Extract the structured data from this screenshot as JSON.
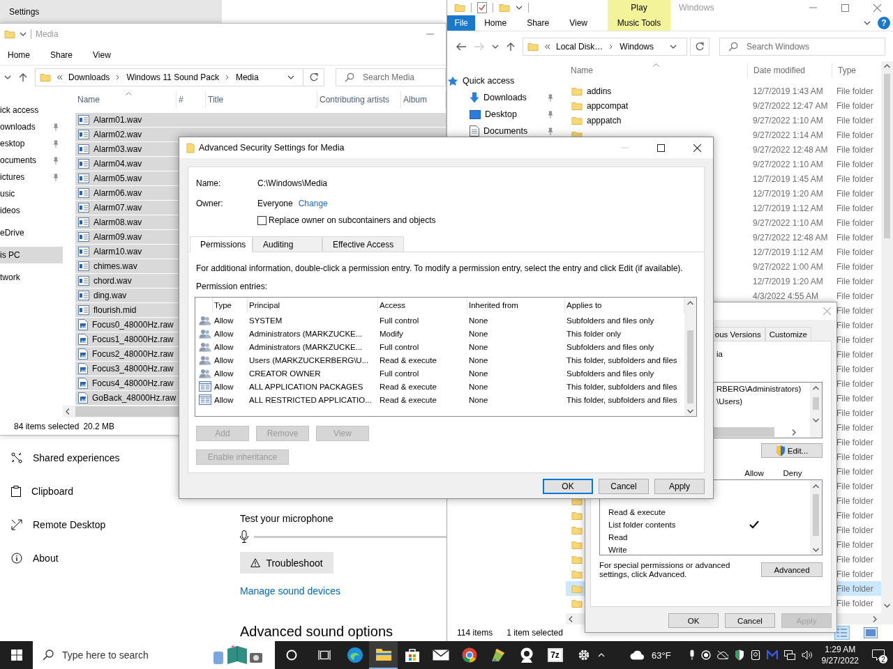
{
  "settings_window": {
    "title": "Settings",
    "nav": [
      {
        "label": "Shared experiences"
      },
      {
        "label": "Clipboard"
      },
      {
        "label": "Remote Desktop"
      },
      {
        "label": "About"
      }
    ],
    "mic_heading": "Test your microphone",
    "troubleshoot_button": "Troubleshoot",
    "manage_link": "Manage sound devices",
    "advanced_heading": "Advanced sound options"
  },
  "media_explorer": {
    "title": "Media",
    "ribbon_tabs": [
      "Home",
      "Share",
      "View"
    ],
    "breadcrumb": [
      "Downloads",
      "Windows 11 Sound Pack",
      "Media"
    ],
    "search_placeholder": "Search Media",
    "nav": [
      {
        "label": "ick access",
        "selected": false,
        "children": [
          {
            "label": "ownloads",
            "pinned": true,
            "selected": false
          },
          {
            "label": "esktop",
            "pinned": true,
            "selected": false
          },
          {
            "label": "ocuments",
            "pinned": true,
            "selected": false
          },
          {
            "label": "ictures",
            "pinned": true,
            "selected": false
          },
          {
            "label": "usic",
            "pinned": false,
            "selected": false
          },
          {
            "label": "ideos",
            "pinned": false,
            "selected": false
          }
        ]
      },
      {
        "label": "eDrive",
        "selected": false
      },
      {
        "label": "is PC",
        "selected": true
      },
      {
        "label": "twork",
        "selected": false
      }
    ],
    "columns": [
      "Name",
      "#",
      "Title",
      "Contributing artists",
      "Album"
    ],
    "files": [
      {
        "name": "Alarm01.wav",
        "kind": "audio",
        "selected": true
      },
      {
        "name": "Alarm02.wav",
        "kind": "audio",
        "selected": true
      },
      {
        "name": "Alarm03.wav",
        "kind": "audio",
        "selected": true
      },
      {
        "name": "Alarm04.wav",
        "kind": "audio",
        "selected": true
      },
      {
        "name": "Alarm05.wav",
        "kind": "audio",
        "selected": true
      },
      {
        "name": "Alarm06.wav",
        "kind": "audio",
        "selected": true
      },
      {
        "name": "Alarm07.wav",
        "kind": "audio",
        "selected": true
      },
      {
        "name": "Alarm08.wav",
        "kind": "audio",
        "selected": true
      },
      {
        "name": "Alarm09.wav",
        "kind": "audio",
        "selected": true
      },
      {
        "name": "Alarm10.wav",
        "kind": "audio",
        "selected": true
      },
      {
        "name": "chimes.wav",
        "kind": "audio",
        "selected": true
      },
      {
        "name": "chord.wav",
        "kind": "audio",
        "selected": true
      },
      {
        "name": "ding.wav",
        "kind": "audio",
        "selected": true
      },
      {
        "name": "flourish.mid",
        "kind": "audio",
        "selected": true
      },
      {
        "name": "Focus0_48000Hz.raw",
        "kind": "raw",
        "selected": true
      },
      {
        "name": "Focus1_48000Hz.raw",
        "kind": "raw",
        "selected": true
      },
      {
        "name": "Focus2_48000Hz.raw",
        "kind": "raw",
        "selected": true
      },
      {
        "name": "Focus3_48000Hz.raw",
        "kind": "raw",
        "selected": true
      },
      {
        "name": "Focus4_48000Hz.raw",
        "kind": "raw",
        "selected": true
      },
      {
        "name": "GoBack_48000Hz.raw",
        "kind": "raw",
        "selected": true
      }
    ],
    "status": "84 items selected",
    "status_size": "20.2 MB"
  },
  "windows_explorer": {
    "title": "Windows",
    "context_tab": {
      "header": "Play",
      "label": "Music Tools"
    },
    "ribbon_tabs": [
      {
        "label": "File",
        "kind": "file_menu"
      },
      {
        "label": "Home",
        "kind": "tab"
      },
      {
        "label": "Share",
        "kind": "tab"
      },
      {
        "label": "View",
        "kind": "tab"
      }
    ],
    "breadcrumb": [
      "Local Disk…",
      "Windows"
    ],
    "search_placeholder": "Search Windows",
    "nav": [
      {
        "label": "Quick access",
        "selected": false,
        "children": [
          {
            "label": "Downloads",
            "pinned": true,
            "selected": false
          },
          {
            "label": "Desktop",
            "pinned": true,
            "selected": false
          },
          {
            "label": "Documents",
            "pinned": true,
            "selected": false
          }
        ]
      }
    ],
    "columns": [
      "Name",
      "Date modified",
      "Type"
    ],
    "rows": [
      {
        "name": "addins",
        "date": "12/7/2019 1:43 AM",
        "type": "File folder",
        "selected": false
      },
      {
        "name": "appcompat",
        "date": "9/27/2022 12:47 AM",
        "type": "File folder",
        "selected": false
      },
      {
        "name": "apppatch",
        "date": "9/27/2022 1:10 AM",
        "type": "File folder",
        "selected": false
      },
      {
        "date": "9/27/2022 1:14 AM",
        "type": "File folder",
        "selected": false
      },
      {
        "date": "9/27/2022 12:48 AM",
        "type": "File folder",
        "selected": false
      },
      {
        "date": "9/27/2022 1:10 AM",
        "type": "File folder",
        "selected": false
      },
      {
        "date": "12/7/2019 1:45 AM",
        "type": "File folder",
        "selected": false
      },
      {
        "date": "12/7/2019 1:20 AM",
        "type": "File folder",
        "selected": false
      },
      {
        "date": "12/7/2019 1:12 AM",
        "type": "File folder",
        "selected": false
      },
      {
        "date": "9/27/2022 1:10 AM",
        "type": "File folder",
        "selected": false
      },
      {
        "date": "9/27/2022 12:48 AM",
        "type": "File folder",
        "selected": false
      },
      {
        "date": "12/7/2019 1:12 AM",
        "type": "File folder",
        "selected": false
      },
      {
        "date": "9/27/2022 1:00 AM",
        "type": "File folder",
        "selected": false
      },
      {
        "date": "12/7/2019 1:20 AM",
        "type": "File folder",
        "selected": false
      },
      {
        "date": "4/3/2022 4:55 AM",
        "type": "File folder",
        "selected": false
      },
      {
        "type": "File folder",
        "selected": false
      },
      {
        "type": "File folder",
        "selected": false
      },
      {
        "type": "File folder",
        "selected": false
      },
      {
        "type": "File folder",
        "selected": false
      },
      {
        "type": "File folder",
        "selected": false
      },
      {
        "type": "File folder",
        "selected": false
      },
      {
        "type": "File folder",
        "selected": false
      },
      {
        "type": "File folder",
        "selected": false
      },
      {
        "type": "File folder",
        "selected": false
      },
      {
        "type": "File folder",
        "selected": false
      },
      {
        "type": "File folder",
        "selected": false
      },
      {
        "type": "File folder",
        "selected": false
      },
      {
        "type": "File folder",
        "selected": false
      },
      {
        "type": "File folder",
        "selected": false
      },
      {
        "type": "File folder",
        "selected": false
      },
      {
        "type": "File folder",
        "selected": false
      },
      {
        "type": "File folder",
        "selected": false
      },
      {
        "type": "File folder",
        "selected": false
      },
      {
        "type": "File folder",
        "selected": false
      },
      {
        "type": "File folder",
        "selected": true
      },
      {
        "type": "File folder",
        "selected": false
      }
    ],
    "help_button": "?",
    "status_count": "114 items",
    "status_selection": "1 item selected"
  },
  "properties_window": {
    "tabs": [
      "ous Versions",
      "Customize"
    ],
    "object_name": "ia",
    "principals": [
      "RBERG\\Administrators)",
      "\\Users)"
    ],
    "edit_button": "Edit...",
    "permission_columns": [
      "Allow",
      "Deny"
    ],
    "permissions": [
      {
        "label": "Read & execute",
        "allow": false
      },
      {
        "label": "List folder contents",
        "allow": true
      },
      {
        "label": "Read",
        "allow": false
      },
      {
        "label": "Write",
        "allow": false
      }
    ],
    "advanced_note": "For special permissions or advanced settings, click Advanced.",
    "advanced_button": "Advanced",
    "buttons": [
      {
        "label": "OK",
        "disabled": false
      },
      {
        "label": "Cancel",
        "disabled": false
      },
      {
        "label": "Apply",
        "disabled": true
      }
    ]
  },
  "security_dialog": {
    "title": "Advanced Security Settings for Media",
    "name_label": "Name:",
    "name_value": "C:\\Windows\\Media",
    "owner_label": "Owner:",
    "owner_value": "Everyone",
    "change_link": "Change",
    "replace_owner": {
      "label": "Replace owner on subcontainers and objects",
      "checked": false
    },
    "tabs": [
      {
        "label": "Permissions",
        "selected": true
      },
      {
        "label": "Auditing",
        "selected": false
      },
      {
        "label": "Effective Access",
        "selected": false
      }
    ],
    "info": "For additional information, double-click a permission entry. To modify a permission entry, select the entry and click Edit (if available).",
    "entries_label": "Permission entries:",
    "columns": [
      "Type",
      "Principal",
      "Access",
      "Inherited from",
      "Applies to"
    ],
    "entries": [
      {
        "kind": "group",
        "type": "Allow",
        "principal": "SYSTEM",
        "access": "Full control",
        "inherited_from": "None",
        "applies_to": "Subfolders and files only"
      },
      {
        "kind": "group",
        "type": "Allow",
        "principal": "Administrators (MARKZUCKE...",
        "access": "Modify",
        "inherited_from": "None",
        "applies_to": "This folder only"
      },
      {
        "kind": "group",
        "type": "Allow",
        "principal": "Administrators (MARKZUCKE...",
        "access": "Full control",
        "inherited_from": "None",
        "applies_to": "Subfolders and files only"
      },
      {
        "kind": "group",
        "type": "Allow",
        "principal": "Users (MARKZUCKERBERG\\U...",
        "access": "Read & execute",
        "inherited_from": "None",
        "applies_to": "This folder, subfolders and files"
      },
      {
        "kind": "group",
        "type": "Allow",
        "principal": "CREATOR OWNER",
        "access": "Full control",
        "inherited_from": "None",
        "applies_to": "Subfolders and files only"
      },
      {
        "kind": "package",
        "type": "Allow",
        "principal": "ALL APPLICATION PACKAGES",
        "access": "Read & execute",
        "inherited_from": "None",
        "applies_to": "This folder, subfolders and files"
      },
      {
        "kind": "package",
        "type": "Allow",
        "principal": "ALL RESTRICTED APPLICATIO...",
        "access": "Read & execute",
        "inherited_from": "None",
        "applies_to": "This folder, subfolders and files"
      }
    ],
    "entry_buttons": [
      {
        "label": "Add",
        "disabled": true
      },
      {
        "label": "Remove",
        "disabled": true
      },
      {
        "label": "View",
        "disabled": true
      }
    ],
    "inheritance_button": {
      "label": "Enable inheritance",
      "disabled": true
    },
    "buttons": [
      {
        "label": "OK",
        "default": true
      },
      {
        "label": "Cancel",
        "default": false
      },
      {
        "label": "Apply",
        "default": false
      }
    ]
  },
  "taskbar": {
    "search_placeholder": "Type here to search",
    "apps": [
      {
        "kind": "cortana",
        "active": false
      },
      {
        "kind": "task_view",
        "active": false
      },
      {
        "kind": "edge",
        "active": false
      },
      {
        "kind": "explorer",
        "active": true
      },
      {
        "kind": "store",
        "active": false
      },
      {
        "kind": "mail",
        "active": false
      },
      {
        "kind": "chrome",
        "active": false
      },
      {
        "kind": "paint",
        "active": false
      },
      {
        "kind": "webcam",
        "active": false
      },
      {
        "kind": "archiver",
        "active": false,
        "label": "7z"
      },
      {
        "kind": "settings",
        "active": false
      }
    ],
    "weather": "63°F",
    "time": "1:29 AM",
    "date": "9/27/2022",
    "notifications": "2"
  }
}
